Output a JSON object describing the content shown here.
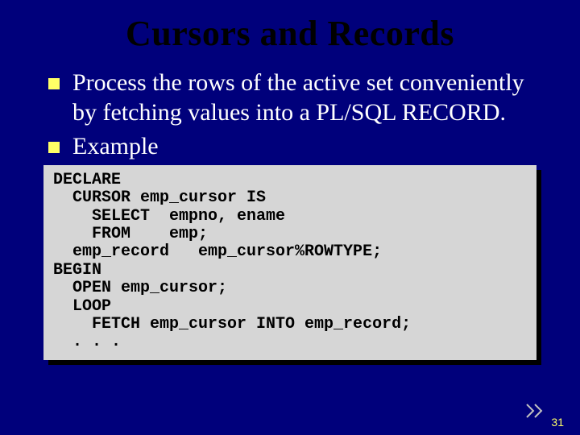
{
  "title": "Cursors and Records",
  "bullets": [
    "Process the rows of the active set conveniently by fetching values into a PL/SQL RECORD.",
    "Example"
  ],
  "code": "DECLARE\n  CURSOR emp_cursor IS\n    SELECT  empno, ename\n    FROM    emp;\n  emp_record   emp_cursor%ROWTYPE;\nBEGIN\n  OPEN emp_cursor;\n  LOOP\n    FETCH emp_cursor INTO emp_record;\n  . . .",
  "page_number": "31"
}
